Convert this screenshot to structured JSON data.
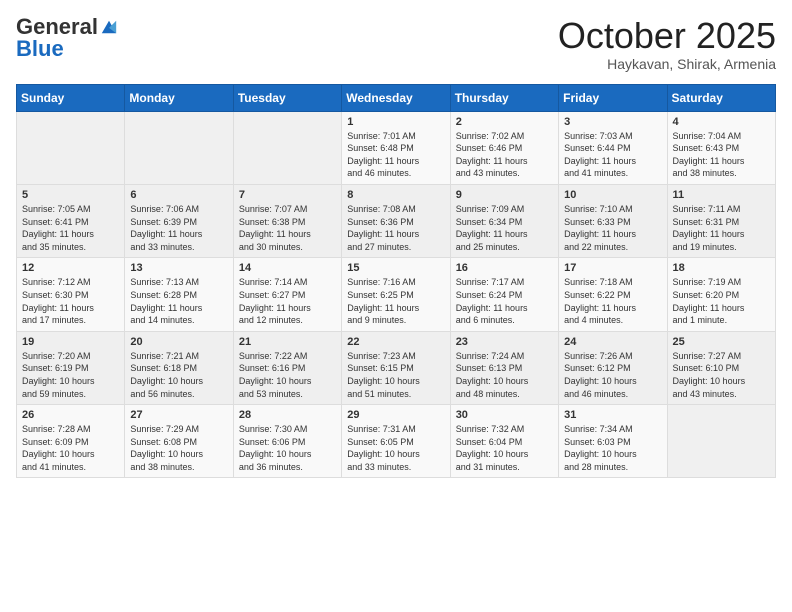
{
  "header": {
    "logo": {
      "general": "General",
      "blue": "Blue"
    },
    "month_title": "October 2025",
    "location": "Haykavan, Shirak, Armenia"
  },
  "weekdays": [
    "Sunday",
    "Monday",
    "Tuesday",
    "Wednesday",
    "Thursday",
    "Friday",
    "Saturday"
  ],
  "weeks": [
    [
      {
        "day": "",
        "info": ""
      },
      {
        "day": "",
        "info": ""
      },
      {
        "day": "",
        "info": ""
      },
      {
        "day": "1",
        "info": "Sunrise: 7:01 AM\nSunset: 6:48 PM\nDaylight: 11 hours\nand 46 minutes."
      },
      {
        "day": "2",
        "info": "Sunrise: 7:02 AM\nSunset: 6:46 PM\nDaylight: 11 hours\nand 43 minutes."
      },
      {
        "day": "3",
        "info": "Sunrise: 7:03 AM\nSunset: 6:44 PM\nDaylight: 11 hours\nand 41 minutes."
      },
      {
        "day": "4",
        "info": "Sunrise: 7:04 AM\nSunset: 6:43 PM\nDaylight: 11 hours\nand 38 minutes."
      }
    ],
    [
      {
        "day": "5",
        "info": "Sunrise: 7:05 AM\nSunset: 6:41 PM\nDaylight: 11 hours\nand 35 minutes."
      },
      {
        "day": "6",
        "info": "Sunrise: 7:06 AM\nSunset: 6:39 PM\nDaylight: 11 hours\nand 33 minutes."
      },
      {
        "day": "7",
        "info": "Sunrise: 7:07 AM\nSunset: 6:38 PM\nDaylight: 11 hours\nand 30 minutes."
      },
      {
        "day": "8",
        "info": "Sunrise: 7:08 AM\nSunset: 6:36 PM\nDaylight: 11 hours\nand 27 minutes."
      },
      {
        "day": "9",
        "info": "Sunrise: 7:09 AM\nSunset: 6:34 PM\nDaylight: 11 hours\nand 25 minutes."
      },
      {
        "day": "10",
        "info": "Sunrise: 7:10 AM\nSunset: 6:33 PM\nDaylight: 11 hours\nand 22 minutes."
      },
      {
        "day": "11",
        "info": "Sunrise: 7:11 AM\nSunset: 6:31 PM\nDaylight: 11 hours\nand 19 minutes."
      }
    ],
    [
      {
        "day": "12",
        "info": "Sunrise: 7:12 AM\nSunset: 6:30 PM\nDaylight: 11 hours\nand 17 minutes."
      },
      {
        "day": "13",
        "info": "Sunrise: 7:13 AM\nSunset: 6:28 PM\nDaylight: 11 hours\nand 14 minutes."
      },
      {
        "day": "14",
        "info": "Sunrise: 7:14 AM\nSunset: 6:27 PM\nDaylight: 11 hours\nand 12 minutes."
      },
      {
        "day": "15",
        "info": "Sunrise: 7:16 AM\nSunset: 6:25 PM\nDaylight: 11 hours\nand 9 minutes."
      },
      {
        "day": "16",
        "info": "Sunrise: 7:17 AM\nSunset: 6:24 PM\nDaylight: 11 hours\nand 6 minutes."
      },
      {
        "day": "17",
        "info": "Sunrise: 7:18 AM\nSunset: 6:22 PM\nDaylight: 11 hours\nand 4 minutes."
      },
      {
        "day": "18",
        "info": "Sunrise: 7:19 AM\nSunset: 6:20 PM\nDaylight: 11 hours\nand 1 minute."
      }
    ],
    [
      {
        "day": "19",
        "info": "Sunrise: 7:20 AM\nSunset: 6:19 PM\nDaylight: 10 hours\nand 59 minutes."
      },
      {
        "day": "20",
        "info": "Sunrise: 7:21 AM\nSunset: 6:18 PM\nDaylight: 10 hours\nand 56 minutes."
      },
      {
        "day": "21",
        "info": "Sunrise: 7:22 AM\nSunset: 6:16 PM\nDaylight: 10 hours\nand 53 minutes."
      },
      {
        "day": "22",
        "info": "Sunrise: 7:23 AM\nSunset: 6:15 PM\nDaylight: 10 hours\nand 51 minutes."
      },
      {
        "day": "23",
        "info": "Sunrise: 7:24 AM\nSunset: 6:13 PM\nDaylight: 10 hours\nand 48 minutes."
      },
      {
        "day": "24",
        "info": "Sunrise: 7:26 AM\nSunset: 6:12 PM\nDaylight: 10 hours\nand 46 minutes."
      },
      {
        "day": "25",
        "info": "Sunrise: 7:27 AM\nSunset: 6:10 PM\nDaylight: 10 hours\nand 43 minutes."
      }
    ],
    [
      {
        "day": "26",
        "info": "Sunrise: 7:28 AM\nSunset: 6:09 PM\nDaylight: 10 hours\nand 41 minutes."
      },
      {
        "day": "27",
        "info": "Sunrise: 7:29 AM\nSunset: 6:08 PM\nDaylight: 10 hours\nand 38 minutes."
      },
      {
        "day": "28",
        "info": "Sunrise: 7:30 AM\nSunset: 6:06 PM\nDaylight: 10 hours\nand 36 minutes."
      },
      {
        "day": "29",
        "info": "Sunrise: 7:31 AM\nSunset: 6:05 PM\nDaylight: 10 hours\nand 33 minutes."
      },
      {
        "day": "30",
        "info": "Sunrise: 7:32 AM\nSunset: 6:04 PM\nDaylight: 10 hours\nand 31 minutes."
      },
      {
        "day": "31",
        "info": "Sunrise: 7:34 AM\nSunset: 6:03 PM\nDaylight: 10 hours\nand 28 minutes."
      },
      {
        "day": "",
        "info": ""
      }
    ]
  ]
}
